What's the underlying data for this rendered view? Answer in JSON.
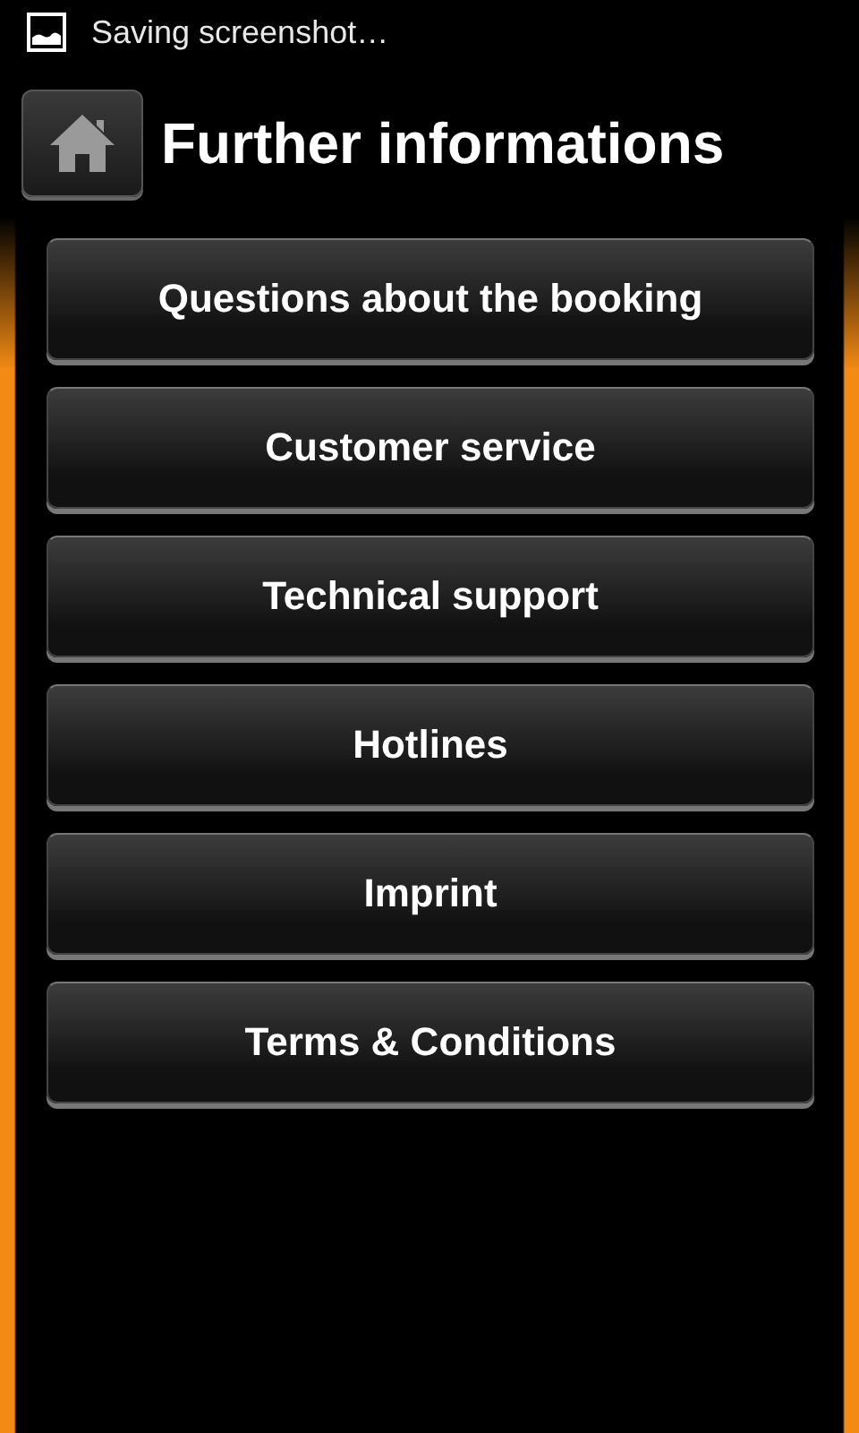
{
  "status_bar": {
    "notification": "Saving screenshot…"
  },
  "header": {
    "title": "Further informations"
  },
  "menu": [
    {
      "label": "Questions about the booking"
    },
    {
      "label": "Customer service"
    },
    {
      "label": "Technical support"
    },
    {
      "label": "Hotlines"
    },
    {
      "label": "Imprint"
    },
    {
      "label": "Terms & Conditions"
    }
  ]
}
